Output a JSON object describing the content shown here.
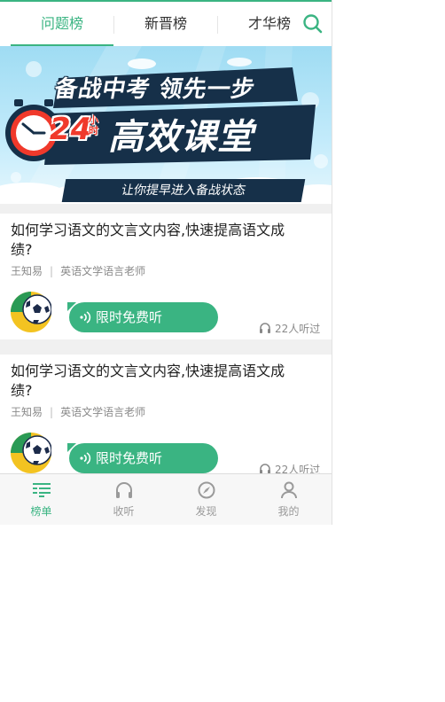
{
  "tabs": [
    {
      "label": "问题榜",
      "active": true
    },
    {
      "label": "新晋榜",
      "active": false
    },
    {
      "label": "才华榜",
      "active": false
    }
  ],
  "search": {
    "icon": "search-icon"
  },
  "banner": {
    "headline": "备战中考 领先一步",
    "number": "24",
    "number_unit": "小时",
    "big_text": "高效课堂",
    "subtitle": "让你提早进入备战状态"
  },
  "cards": [
    {
      "title": "如何学习语文的文言文内容,快速提高语文成绩?",
      "author": "王知易",
      "author_role": "英语文学语言老师",
      "listen_label": "限时免费听",
      "listen_count": "22人听过"
    },
    {
      "title": "如何学习语文的文言文内容,快速提高语文成绩?",
      "author": "王知易",
      "author_role": "英语文学语言老师",
      "listen_label": "限时免费听",
      "listen_count": "22人听过"
    }
  ],
  "bottom_nav": [
    {
      "label": "榜单",
      "icon": "list-icon",
      "active": true
    },
    {
      "label": "收听",
      "icon": "headphones-icon",
      "active": false
    },
    {
      "label": "发现",
      "icon": "compass-icon",
      "active": false
    },
    {
      "label": "我的",
      "icon": "user-icon",
      "active": false
    }
  ],
  "colors": {
    "accent": "#3ab482",
    "banner_dark": "#163049",
    "banner_red": "#f0392b"
  }
}
